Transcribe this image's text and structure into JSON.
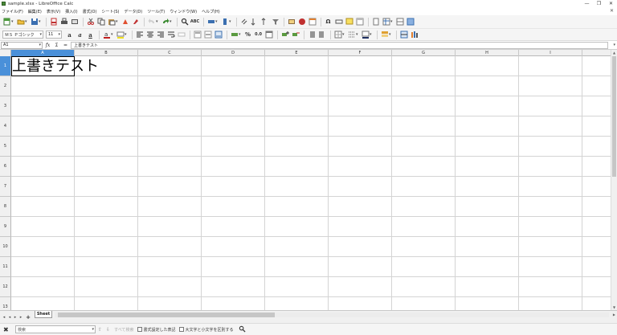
{
  "window": {
    "title": "sample.xlsx - LibreOffice Calc",
    "minimize": "—",
    "maximize": "❐",
    "close": "✕"
  },
  "menu": {
    "items": [
      "ファイル(F)",
      "編集(E)",
      "表示(V)",
      "挿入(I)",
      "書式(O)",
      "シート(S)",
      "データ(D)",
      "ツール(T)",
      "ウィンドウ(W)",
      "ヘルプ(H)"
    ],
    "close": "✕"
  },
  "format_toolbar": {
    "font_name": "ＭＳ Ｐゴシック",
    "font_size": "11"
  },
  "formula_bar": {
    "name_box": "A1",
    "content": "上書きテスト",
    "sum_symbol": "Σ",
    "equals_symbol": "="
  },
  "grid": {
    "columns": [
      "A",
      "B",
      "C",
      "D",
      "E",
      "F",
      "G",
      "H",
      "I"
    ],
    "rows": [
      "1",
      "2",
      "3",
      "4",
      "5",
      "6",
      "7",
      "8",
      "9",
      "10",
      "11",
      "12",
      "13"
    ],
    "selected_cell": "A1",
    "cell_a1": "上書きテスト"
  },
  "sheets": {
    "tabs": [
      "Sheet"
    ],
    "add": "+"
  },
  "find_bar": {
    "placeholder": "検索",
    "find_all": "すべて検索",
    "formatted_display": "書式設定した表記",
    "match_case": "大文字と小文字を区別する"
  },
  "colors": {
    "selection": "#4a90d9",
    "grid_line": "#d4d4d4",
    "header_bg": "#f0f0f0"
  }
}
